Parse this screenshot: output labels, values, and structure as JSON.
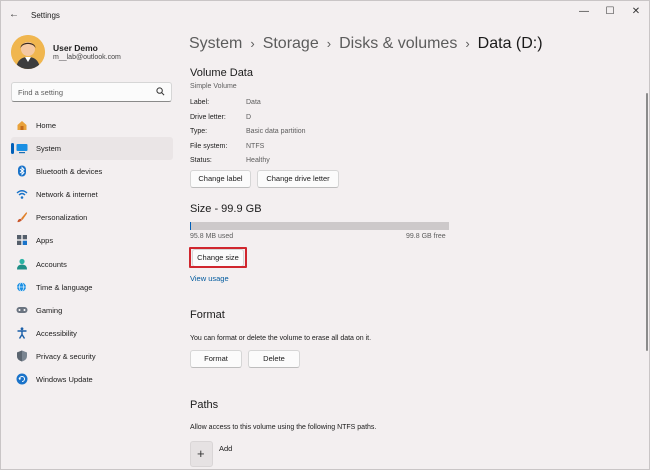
{
  "window": {
    "app_title": "Settings",
    "back_glyph": "←",
    "minimize_glyph": "—",
    "maximize_glyph": "☐",
    "close_glyph": "✕"
  },
  "profile": {
    "name": "User Demo",
    "email": "m__lab@outlook.com"
  },
  "search": {
    "placeholder": "Find a setting",
    "icon": "search-icon",
    "icon_glyph": "⌕"
  },
  "sidebar": {
    "items": [
      {
        "label": "Home",
        "icon": "home-icon",
        "selected": false
      },
      {
        "label": "System",
        "icon": "system-icon",
        "selected": true
      },
      {
        "label": "Bluetooth & devices",
        "icon": "bluetooth-icon",
        "selected": false
      },
      {
        "label": "Network & internet",
        "icon": "network-icon",
        "selected": false
      },
      {
        "label": "Personalization",
        "icon": "brush-icon",
        "selected": false
      },
      {
        "label": "Apps",
        "icon": "apps-icon",
        "selected": false
      },
      {
        "label": "Accounts",
        "icon": "accounts-icon",
        "selected": false
      },
      {
        "label": "Time & language",
        "icon": "globe-clock-icon",
        "selected": false
      },
      {
        "label": "Gaming",
        "icon": "gamepad-icon",
        "selected": false
      },
      {
        "label": "Accessibility",
        "icon": "accessibility-icon",
        "selected": false
      },
      {
        "label": "Privacy & security",
        "icon": "shield-icon",
        "selected": false
      },
      {
        "label": "Windows Update",
        "icon": "update-icon",
        "selected": false
      }
    ]
  },
  "breadcrumb": {
    "items": [
      "System",
      "Storage",
      "Disks & volumes",
      "Data (D:)"
    ],
    "separator": "›"
  },
  "volume_data": {
    "title": "Volume Data",
    "subtitle": "Simple Volume",
    "properties": [
      {
        "label": "Label:",
        "value": "Data"
      },
      {
        "label": "Drive letter:",
        "value": "D"
      },
      {
        "label": "Type:",
        "value": "Basic data partition"
      },
      {
        "label": "File system:",
        "value": "NTFS"
      },
      {
        "label": "Status:",
        "value": "Healthy"
      }
    ],
    "change_label_button": "Change label",
    "change_drive_letter_button": "Change drive letter"
  },
  "size": {
    "title": "Size - 99.9 GB",
    "used_text": "95.8 MB used",
    "free_text": "99.8 GB free",
    "used_fraction": 0.001,
    "change_size_button": "Change size",
    "view_usage_link": "View usage"
  },
  "format": {
    "title": "Format",
    "description": "You can format or delete the volume to erase all data on it.",
    "format_button": "Format",
    "delete_button": "Delete"
  },
  "paths": {
    "title": "Paths",
    "description": "Allow access to this volume using the following NTFS paths.",
    "add_label": "Add",
    "add_glyph": "+"
  },
  "colors": {
    "accent": "#005fb8",
    "highlight": "#d0262e",
    "background": "#f3eff0"
  }
}
